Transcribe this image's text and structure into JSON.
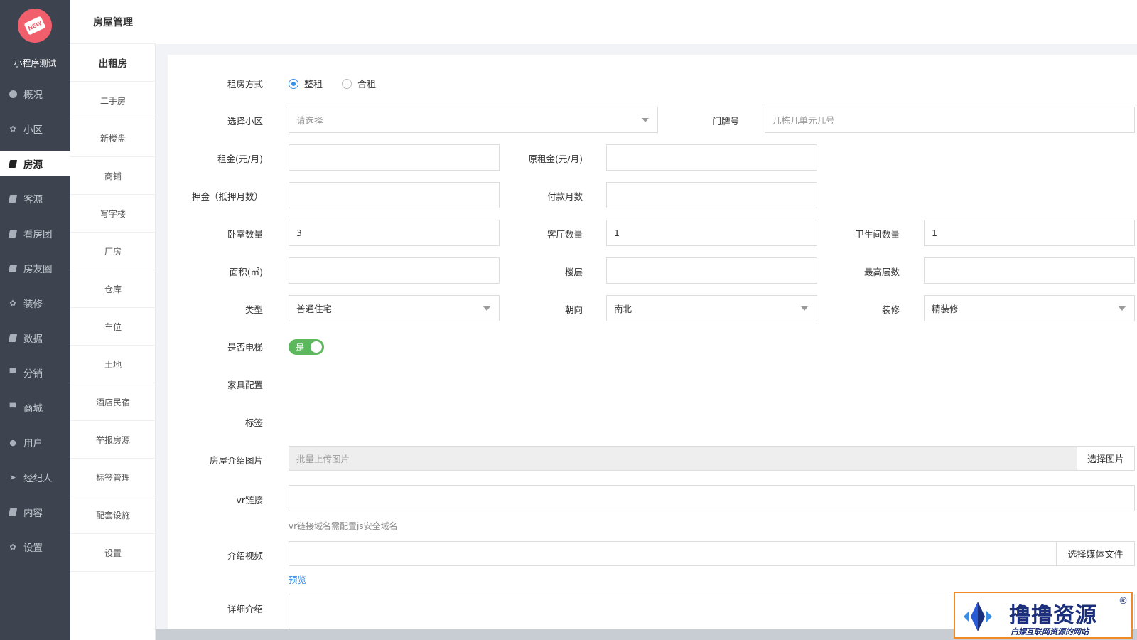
{
  "app": {
    "name": "小程序测试",
    "logo_badge": "NEW"
  },
  "main_nav": [
    {
      "label": "概况",
      "icon": "dashboard-icon"
    },
    {
      "label": "小区",
      "icon": "gear-icon"
    },
    {
      "label": "房源",
      "icon": "book-icon",
      "active": true
    },
    {
      "label": "客源",
      "icon": "book-icon"
    },
    {
      "label": "看房团",
      "icon": "book-icon"
    },
    {
      "label": "房友圈",
      "icon": "book-icon"
    },
    {
      "label": "装修",
      "icon": "gear-icon"
    },
    {
      "label": "数据",
      "icon": "book-icon"
    },
    {
      "label": "分销",
      "icon": "cart-icon"
    },
    {
      "label": "商城",
      "icon": "cart-icon"
    },
    {
      "label": "用户",
      "icon": "user-icon"
    },
    {
      "label": "经纪人",
      "icon": "twitter-icon"
    },
    {
      "label": "内容",
      "icon": "book-icon"
    },
    {
      "label": "设置",
      "icon": "gear-icon"
    }
  ],
  "sub_nav": {
    "title": "房屋管理",
    "items": [
      "出租房",
      "二手房",
      "新楼盘",
      "商铺",
      "写字楼",
      "厂房",
      "仓库",
      "车位",
      "土地",
      "酒店民宿",
      "举报房源",
      "标签管理",
      "配套设施",
      "设置"
    ]
  },
  "form": {
    "rent_type": {
      "label": "租房方式",
      "options": [
        "整租",
        "合租"
      ],
      "selected": "整租"
    },
    "community": {
      "label": "选择小区",
      "placeholder": "请选择"
    },
    "door_no": {
      "label": "门牌号",
      "placeholder": "几栋几单元几号"
    },
    "rent": {
      "label": "租金(元/月)",
      "value": ""
    },
    "orig_rent": {
      "label": "原租金(元/月)",
      "value": ""
    },
    "deposit": {
      "label": "押金（抵押月数）",
      "value": ""
    },
    "pay_months": {
      "label": "付款月数",
      "value": ""
    },
    "bedrooms": {
      "label": "卧室数量",
      "value": "3"
    },
    "livingrooms": {
      "label": "客厅数量",
      "value": "1"
    },
    "bathrooms": {
      "label": "卫生间数量",
      "value": "1"
    },
    "area": {
      "label": "面积(㎡)",
      "value": ""
    },
    "floor": {
      "label": "楼层",
      "value": ""
    },
    "max_floor": {
      "label": "最高层数",
      "value": ""
    },
    "type": {
      "label": "类型",
      "value": "普通住宅"
    },
    "orientation": {
      "label": "朝向",
      "value": "南北"
    },
    "decoration": {
      "label": "装修",
      "value": "精装修"
    },
    "elevator": {
      "label": "是否电梯",
      "value": "是",
      "on": true
    },
    "furniture": {
      "label": "家具配置"
    },
    "tags": {
      "label": "标签"
    },
    "images": {
      "label": "房屋介绍图片",
      "placeholder": "批量上传图片",
      "button": "选择图片"
    },
    "vr": {
      "label": "vr链接",
      "value": "",
      "help": "vr链接域名需配置js安全域名"
    },
    "video": {
      "label": "介绍视频",
      "value": "",
      "button": "选择媒体文件",
      "preview": "预览"
    },
    "detail": {
      "label": "详细介绍"
    }
  },
  "watermark": {
    "title": "撸撸资源",
    "subtitle": "白嫖互联网资源的网站",
    "reg": "®"
  },
  "colors": {
    "sidebar": "#3d4450",
    "accent": "#3a8ee6",
    "toggle": "#5cb85c",
    "watermark_border": "#f08a24"
  }
}
